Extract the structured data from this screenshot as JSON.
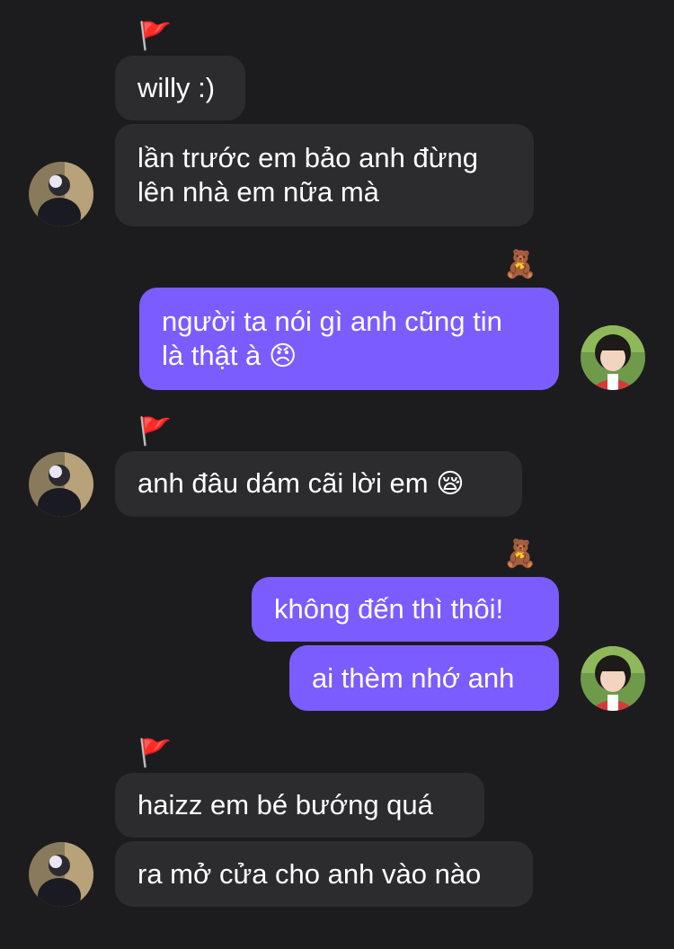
{
  "conversation": {
    "messages": [
      {
        "id": "m1",
        "sender": "other",
        "lines": [
          "willy :)"
        ]
      },
      {
        "id": "m2",
        "sender": "other",
        "lines": [
          "lần trước em bảo anh đừng",
          "lên nhà em nữa mà"
        ]
      },
      {
        "id": "m3",
        "sender": "me",
        "lines": [
          "người ta nói gì anh cũng tin",
          "là thật à"
        ],
        "emoji": "😠"
      },
      {
        "id": "m4",
        "sender": "other",
        "lines": [
          "anh đâu dám cãi lời em"
        ],
        "emoji": "😪"
      },
      {
        "id": "m5",
        "sender": "me",
        "lines": [
          "không đến thì thôi!"
        ]
      },
      {
        "id": "m6",
        "sender": "me",
        "lines": [
          "ai thèm nhớ anh"
        ]
      },
      {
        "id": "m7",
        "sender": "other",
        "lines": [
          "haizz em bé bướng quá"
        ]
      },
      {
        "id": "m8",
        "sender": "other",
        "lines": [
          "ra mở cửa cho anh vào nào"
        ]
      }
    ],
    "reactions": {
      "flag_icon": "red-flag-icon",
      "bear_icon": "teddy-bear-icon",
      "flag_glyph": "🚩",
      "bear_glyph": "🧸"
    }
  },
  "colors": {
    "background": "#1c1c1e",
    "incoming_bubble": "#2c2c2e",
    "outgoing_bubble": "#7b5cff",
    "text": "#ffffff"
  }
}
